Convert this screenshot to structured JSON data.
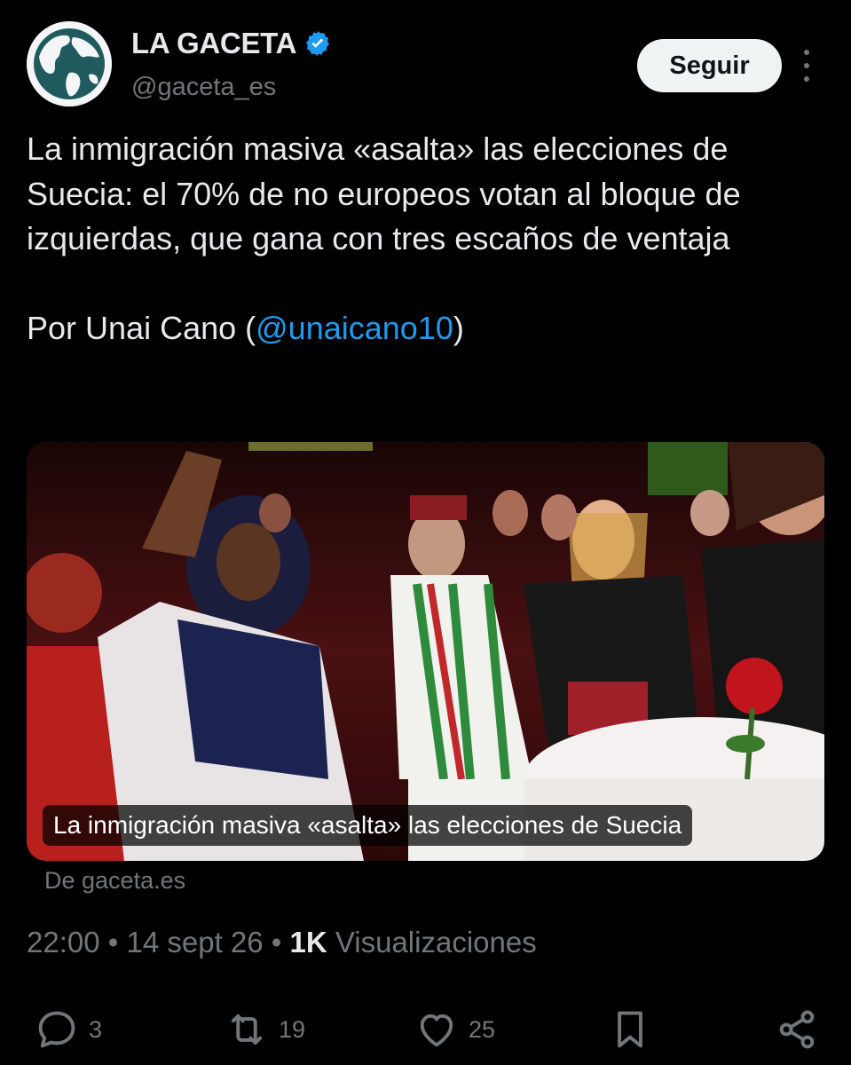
{
  "author": {
    "name": "LA GACETA",
    "handle": "@gaceta_es",
    "verified": true,
    "avatar_icon": "globe-icon"
  },
  "follow_label": "Seguir",
  "tweet": {
    "text": "La inmigración masiva «asalta» las elecciones de Suecia: el 70% de no europeos votan al bloque de izquierdas, que gana con tres escaños de ventaja",
    "byline_prefix": "Por Unai Cano (",
    "byline_mention": "@unaicano10",
    "byline_suffix": ")"
  },
  "card": {
    "caption": "La inmigración masiva «asalta» las elecciones de Suecia",
    "source": "De gaceta.es"
  },
  "meta": {
    "time": "22:00",
    "sep1": " • ",
    "date": "14 sept 26",
    "sep2": " • ",
    "views_count": "1K",
    "views_label": " Visualizaciones"
  },
  "actions": {
    "replies": "3",
    "retweets": "19",
    "likes": "25"
  },
  "colors": {
    "background": "#000000",
    "text": "#e7e9ea",
    "muted": "#71767b",
    "link": "#1d9bf0",
    "verified": "#1d9bf0"
  }
}
